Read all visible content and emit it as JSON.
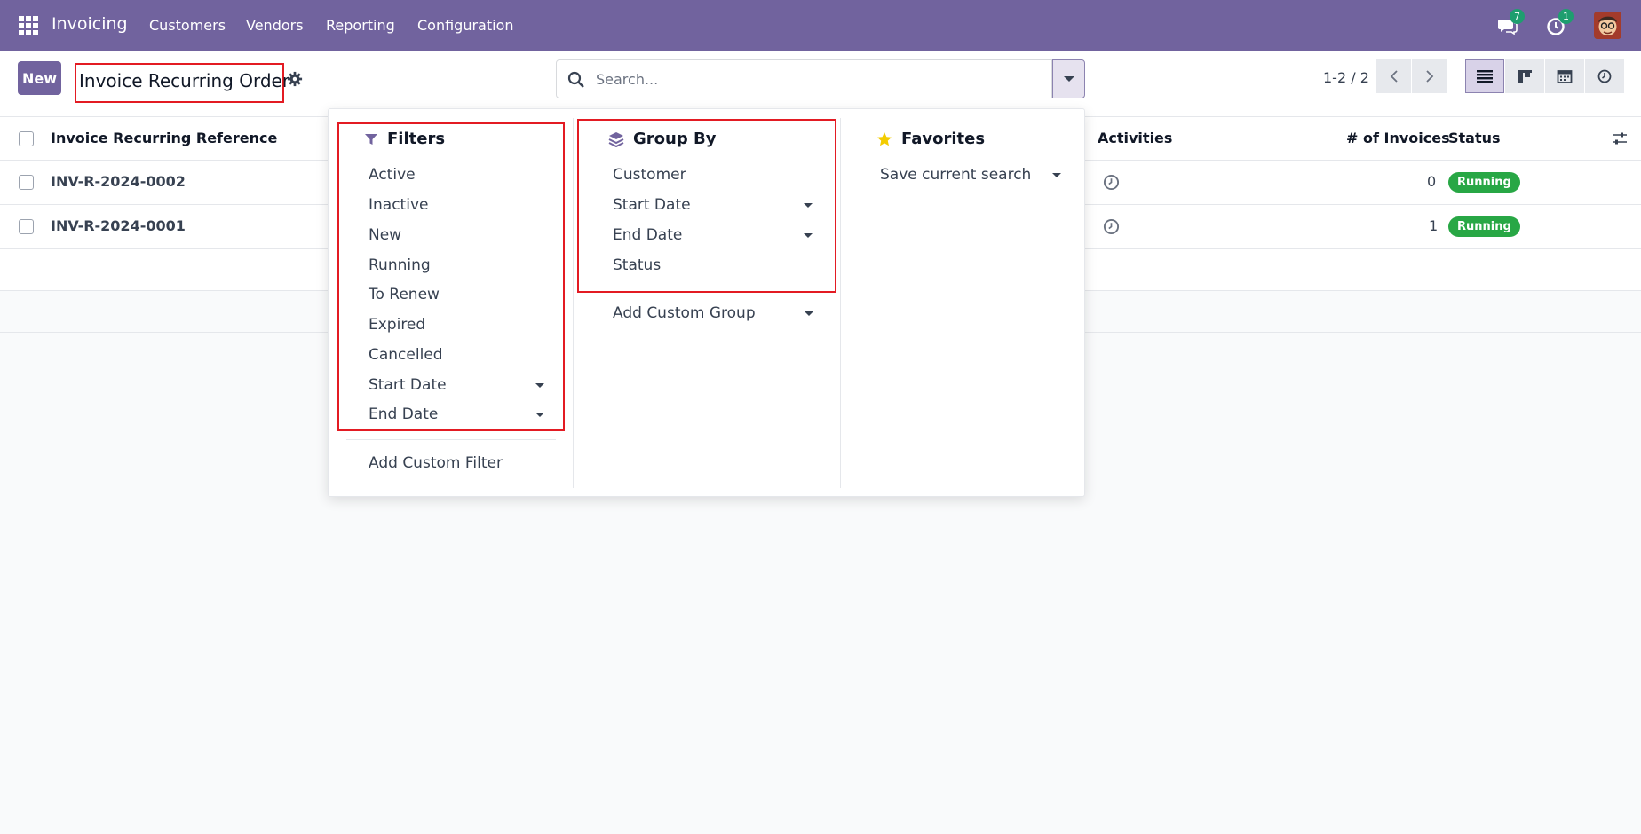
{
  "navbar": {
    "app_name": "Invoicing",
    "menu": [
      "Customers",
      "Vendors",
      "Reporting",
      "Configuration"
    ],
    "messages_count": "7",
    "activities_count": "1",
    "bg_color": "#71639e"
  },
  "control": {
    "new_label": "New",
    "page_title": "Invoice Recurring Order",
    "search_placeholder": "Search...",
    "pager": "1-2 / 2"
  },
  "table": {
    "headers": {
      "reference": "Invoice Recurring Reference",
      "activities": "Activities",
      "invoices": "# of Invoices",
      "status": "Status"
    },
    "rows": [
      {
        "reference": "INV-R-2024-0002",
        "invoices": "0",
        "status": "Running"
      },
      {
        "reference": "INV-R-2024-0001",
        "invoices": "1",
        "status": "Running"
      }
    ]
  },
  "dropdown": {
    "filters": {
      "title": "Filters",
      "items": [
        "Active",
        "Inactive",
        "New",
        "Running",
        "To Renew",
        "Expired",
        "Cancelled",
        "Start Date",
        "End Date"
      ],
      "add_custom": "Add Custom Filter"
    },
    "group_by": {
      "title": "Group By",
      "items": [
        "Customer",
        "Start Date",
        "End Date",
        "Status"
      ],
      "add_custom": "Add Custom Group"
    },
    "favorites": {
      "title": "Favorites",
      "items": [
        "Save current search"
      ]
    }
  },
  "colors": {
    "accent": "#71639e",
    "running_badge": "#28a745",
    "highlight": "#e31b23"
  }
}
